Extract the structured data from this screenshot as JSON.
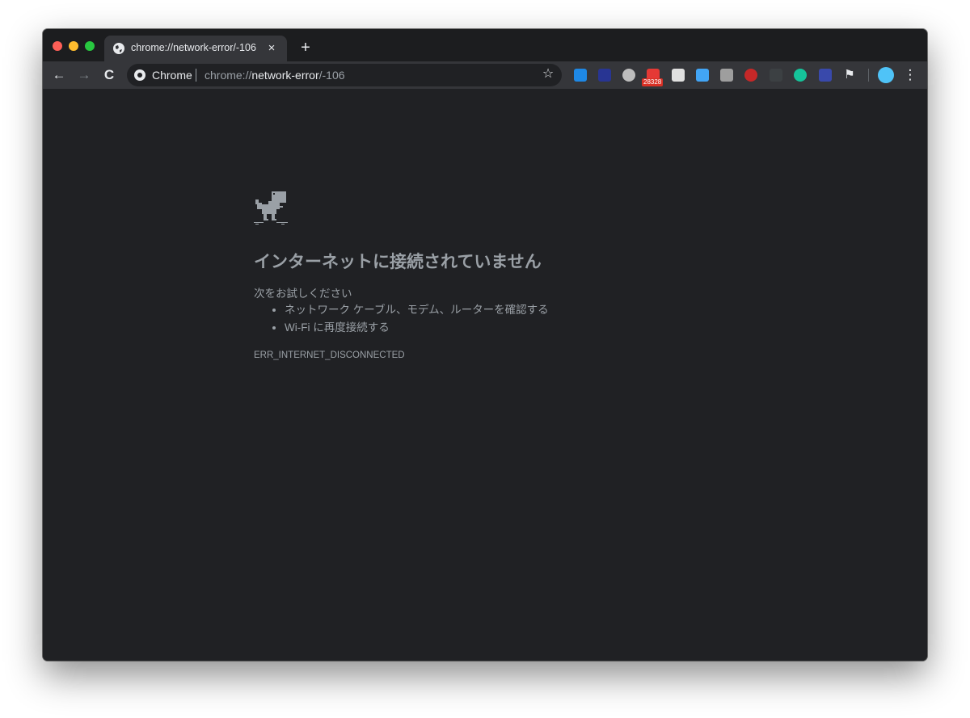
{
  "tab": {
    "title": "chrome://network-error/-106",
    "close_label": "×",
    "new_tab_label": "+"
  },
  "toolbar": {
    "back_label": "←",
    "forward_label": "→",
    "reload_label": "C",
    "menu_label": "⋮",
    "extension_badge": "28328"
  },
  "omnibox": {
    "chip": "Chrome",
    "url_prefix": "chrome://",
    "url_host": "network-error",
    "url_path": "/-106",
    "star_label": "☆"
  },
  "page": {
    "headline": "インターネットに接続されていません",
    "suggestions_title": "次をお試しください",
    "suggestions": [
      "ネットワーク ケーブル、モデム、ルーターを確認する",
      "Wi-Fi に再度接続する"
    ],
    "error_code": "ERR_INTERNET_DISCONNECTED"
  },
  "colors": {
    "content_bg": "#202124",
    "toolbar_bg": "#35363a",
    "text_muted": "#9aa0a6"
  }
}
